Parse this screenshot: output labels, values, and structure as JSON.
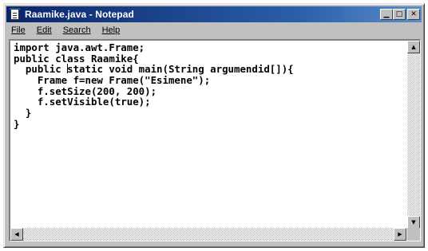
{
  "window": {
    "title": "Raamike.java - Notepad",
    "icon": "notepad-icon",
    "controls": {
      "minimize": "▁",
      "maximize": "□",
      "close": "✕"
    }
  },
  "menu": {
    "items": [
      "File",
      "Edit",
      "Search",
      "Help"
    ]
  },
  "editor": {
    "lines": [
      "import java.awt.Frame;",
      "public class Raamike{",
      "  public static void main(String argumendid[]){",
      "    Frame f=new Frame(\"Esimene\");",
      "    f.setSize(200, 200);",
      "    f.setVisible(true);",
      "  }",
      "}"
    ]
  },
  "scrollbars": {
    "up": "▲",
    "down": "▼",
    "left": "◀",
    "right": "▶"
  }
}
